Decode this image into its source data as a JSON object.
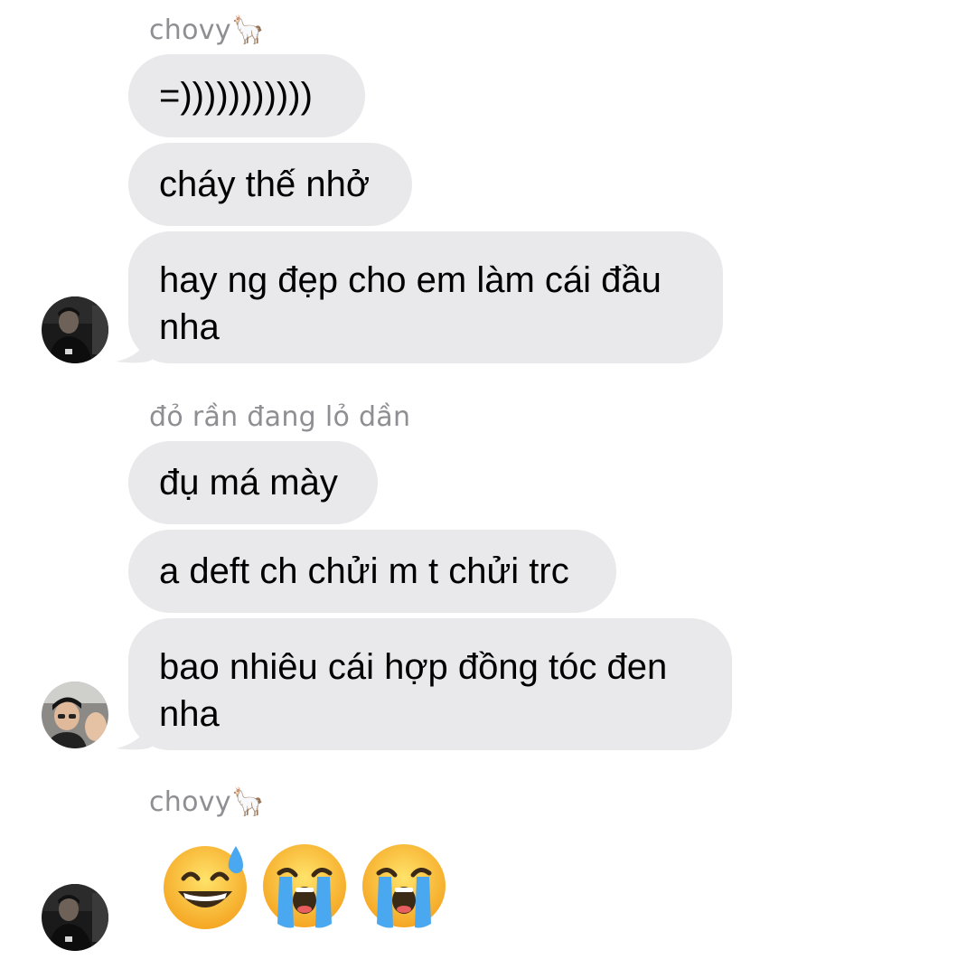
{
  "groups": [
    {
      "sender": "chovy🦙",
      "messages": [
        "=)))))))))))",
        "cháy thế nhở",
        "hay ng đẹp cho em làm cái đầu nha"
      ]
    },
    {
      "sender": "đỏ rần đang lỏ dần",
      "messages": [
        "đụ má mày",
        "a deft ch chửi m t chửi trc",
        "bao nhiêu cái hợp đồng tóc đen nha"
      ]
    },
    {
      "sender": "chovy🦙",
      "emojis": [
        "grinning-face-with-sweat-icon",
        "loudly-crying-face-icon",
        "loudly-crying-face-icon"
      ]
    }
  ],
  "colors": {
    "bubble_bg": "#e9e9eb",
    "sender_text": "#8e8e93",
    "background": "#ffffff"
  }
}
